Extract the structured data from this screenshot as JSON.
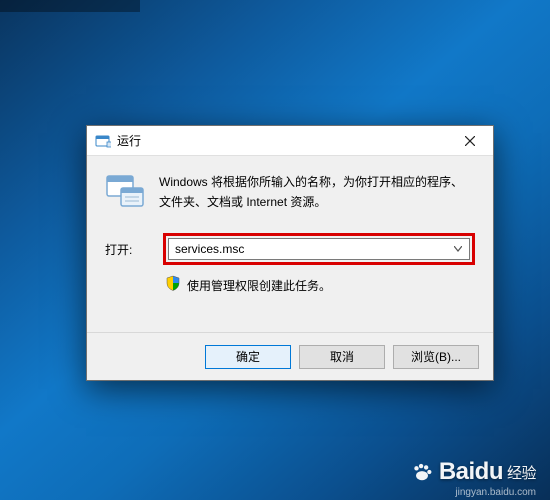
{
  "dialog": {
    "title": "运行",
    "info": "Windows 将根据你所输入的名称，为你打开相应的程序、文件夹、文档或 Internet 资源。",
    "open_label": "打开:",
    "input_value": "services.msc",
    "shield_text": "使用管理权限创建此任务。",
    "buttons": {
      "ok": "确定",
      "cancel": "取消",
      "browse": "浏览(B)..."
    }
  },
  "watermark": {
    "brand": "Baidu",
    "sub_brand": "经验",
    "url": "jingyan.baidu.com"
  }
}
